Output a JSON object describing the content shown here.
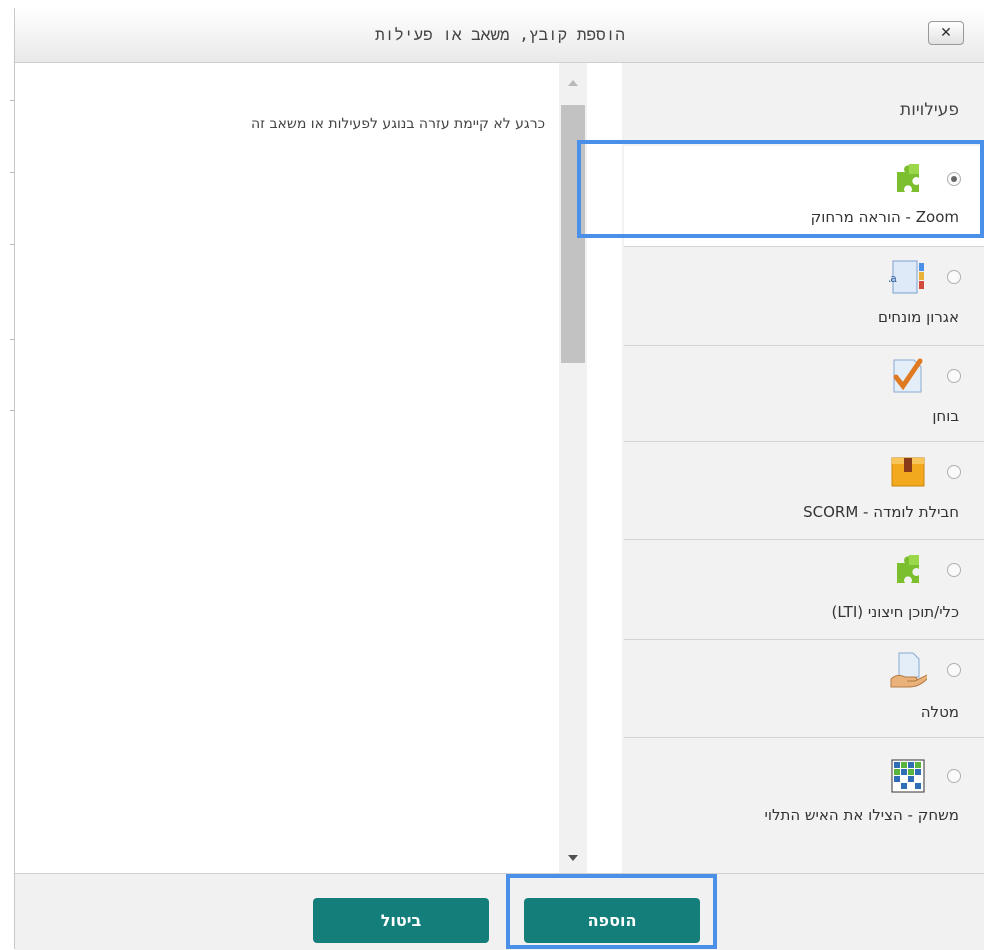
{
  "dialog": {
    "title": "הוספת קובץ, משאב או פעילות",
    "close_symbol": "✕"
  },
  "options": {
    "section_title": "פעילויות",
    "items": [
      {
        "label": "Zoom - הוראה מרחוק",
        "icon": "puzzle-icon",
        "selected": true
      },
      {
        "label": "אגרון מונחים",
        "icon": "glossary-icon",
        "selected": false
      },
      {
        "label": "בוחן",
        "icon": "quiz-icon",
        "selected": false
      },
      {
        "label": "חבילת לומדה - SCORM",
        "icon": "scorm-package-icon",
        "selected": false
      },
      {
        "label": "כלי/תוכן חיצוני (LTI)",
        "icon": "puzzle-icon",
        "selected": false
      },
      {
        "label": "מטלה",
        "icon": "assignment-icon",
        "selected": false
      },
      {
        "label": "משחק - הצילו את האיש התלוי",
        "icon": "hangman-game-icon",
        "selected": false
      }
    ]
  },
  "help": {
    "text": "כרגע לא קיימת עזרה בנוגע לפעילות או משאב זה"
  },
  "footer": {
    "add_label": "הוספה",
    "cancel_label": "ביטול"
  },
  "colors": {
    "button": "#147f7a",
    "highlight": "#4a8fe8",
    "options_bg": "#f2f2f2",
    "puzzle_green": "#7cbf2e"
  }
}
